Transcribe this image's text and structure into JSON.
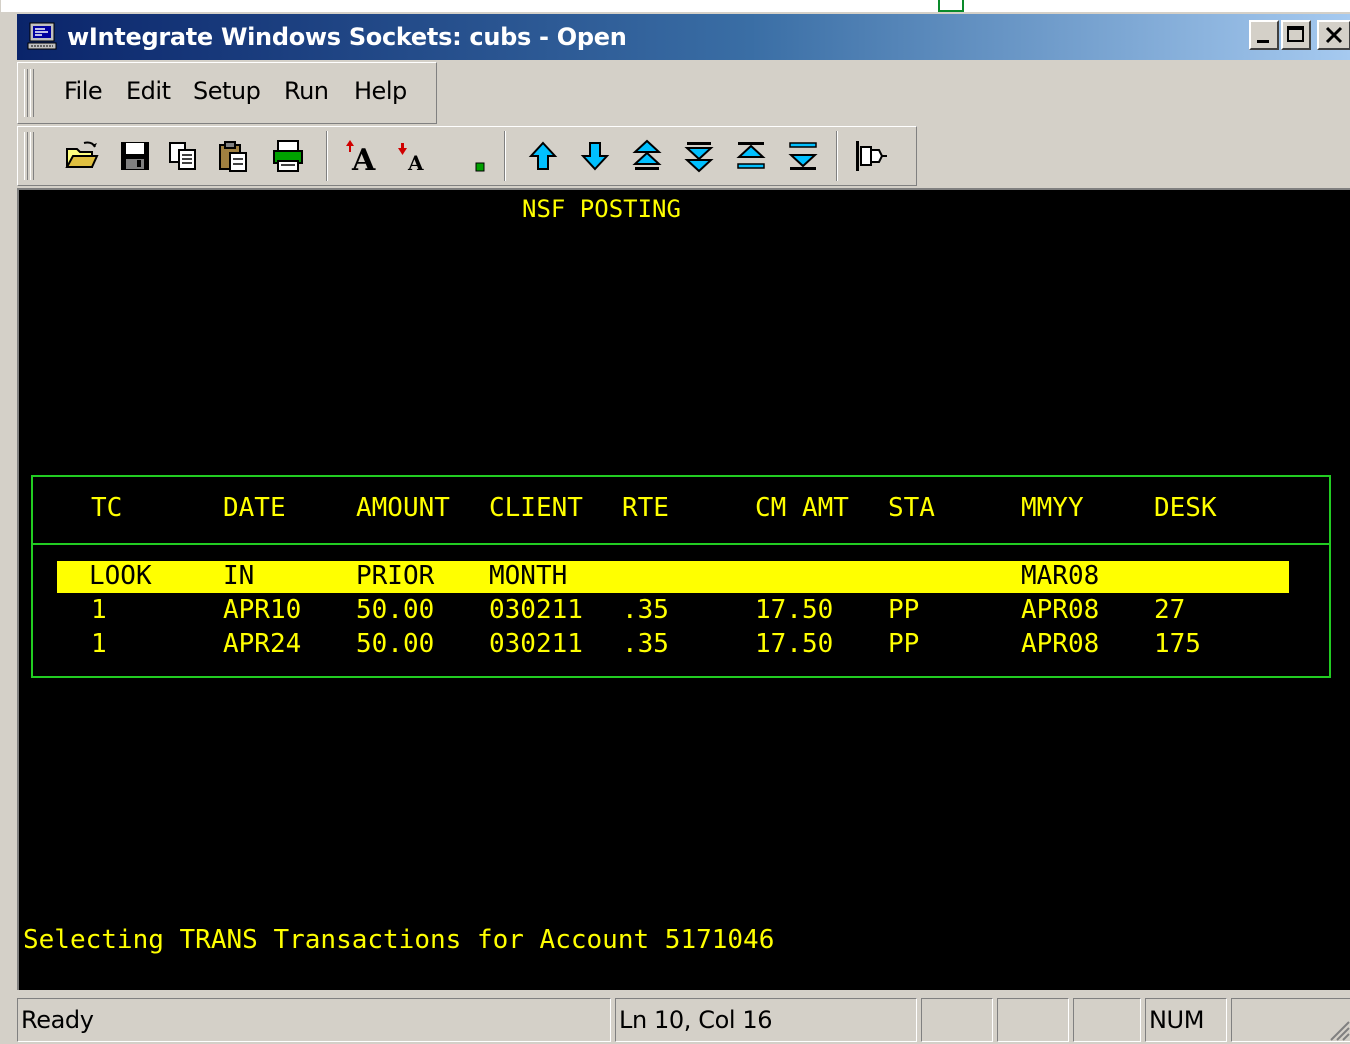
{
  "window": {
    "title": "wIntegrate Windows Sockets: cubs - Open"
  },
  "menu": {
    "items": [
      {
        "label": "File"
      },
      {
        "label": "Edit"
      },
      {
        "label": "Setup"
      },
      {
        "label": "Run"
      },
      {
        "label": "Help"
      }
    ]
  },
  "toolbar": {
    "buttons": [
      "open-folder-icon",
      "save-disk-icon",
      "copy-icon",
      "paste-icon",
      "print-icon",
      "increase-font-icon",
      "decrease-font-icon",
      "small-square-icon",
      "arrow-up-icon",
      "arrow-down-icon",
      "page-up-icon",
      "page-down-icon",
      "to-top-icon",
      "to-bottom-icon",
      "disconnect-plug-icon"
    ]
  },
  "terminal": {
    "screen_title": "NSF POSTING",
    "columns": [
      "TC",
      "DATE",
      "AMOUNT",
      "CLIENT",
      "RTE",
      "CM AMT",
      "STA",
      "MMYY",
      "DESK"
    ],
    "highlight_row": {
      "tc": "LOOK",
      "date": "IN",
      "amount": "PRIOR",
      "client": "MONTH",
      "rte": "",
      "cm_amt": "",
      "sta": "",
      "mmyy": "MAR08",
      "desk": ""
    },
    "rows": [
      {
        "tc": "1",
        "date": "APR10",
        "amount": "50.00",
        "client": "030211",
        "rte": ".35",
        "cm_amt": "17.50",
        "sta": "PP",
        "mmyy": "APR08",
        "desk": "27"
      },
      {
        "tc": "1",
        "date": "APR24",
        "amount": "50.00",
        "client": "030211",
        "rte": ".35",
        "cm_amt": "17.50",
        "sta": "PP",
        "mmyy": "APR08",
        "desk": "175"
      }
    ],
    "message": "Selecting TRANS Transactions for Account 5171046"
  },
  "statusbar": {
    "state": "Ready",
    "position": "Ln 10, Col 16",
    "num": "NUM"
  },
  "colors": {
    "terminal_bg": "#000000",
    "terminal_text": "#ffff00",
    "box_border": "#22cc22",
    "titlebar_start": "#0a246a",
    "titlebar_end": "#a6caf0"
  }
}
